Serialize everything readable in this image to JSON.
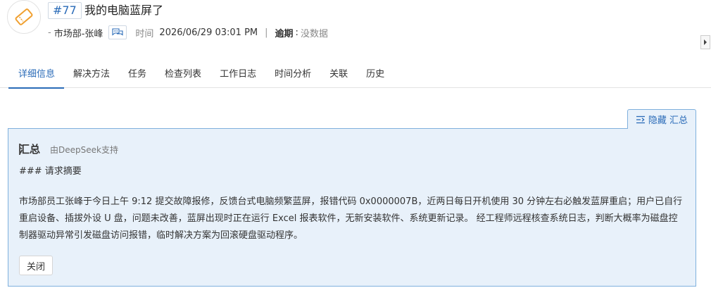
{
  "ticket": {
    "id": "#77",
    "title": "我的电脑蓝屏了",
    "requester": "市场部-张峰",
    "time_label": "时间",
    "time_value": "2026/06/29 03:01 PM",
    "due_label": "逾期",
    "due_value": "没数据"
  },
  "tabs": [
    {
      "label": "详细信息",
      "active": true
    },
    {
      "label": "解决方法"
    },
    {
      "label": "任务"
    },
    {
      "label": "检查列表"
    },
    {
      "label": "工作日志"
    },
    {
      "label": "时间分析"
    },
    {
      "label": "关联"
    },
    {
      "label": "历史"
    }
  ],
  "summary": {
    "toggle_label": "隐藏 汇总",
    "title": "汇总",
    "source": "由DeepSeek支持",
    "subheading": "### 请求摘要",
    "body": "市场部员工张峰于今日上午 9:12 提交故障报修，反馈台式电脑频繁蓝屏，报错代码 0x0000007B，近两日每日开机使用 30 分钟左右必触发蓝屏重启；用户已自行重启设备、插拔外设 U 盘，问题未改善，蓝屏出现时正在运行 Excel 报表软件，无新安装软件、系统更新记录。 经工程师远程核查系统日志，判断大概率为磁盘控制器驱动异常引发磁盘访问报错，临时解决方案为回滚硬盘驱动程序。",
    "close_label": "关闭"
  },
  "colors": {
    "accent": "#2a6bb8",
    "summary_bg": "#e8f1fa",
    "summary_border": "#7fb0dd",
    "icon_orange": "#f0a030"
  }
}
